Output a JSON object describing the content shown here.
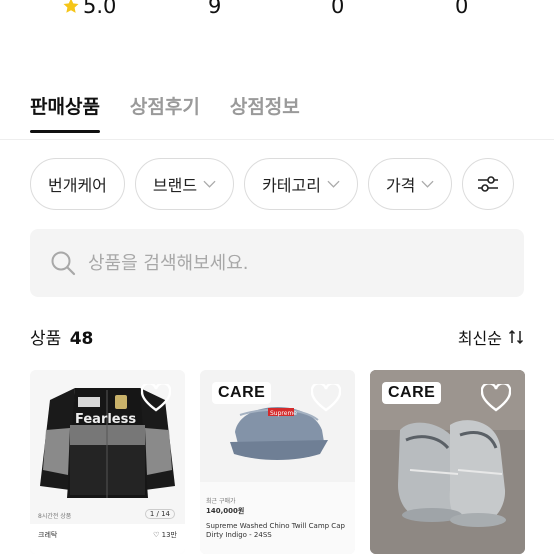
{
  "stats": {
    "rating": "5.0",
    "value_2": "9",
    "value_3": "0",
    "value_4": "0"
  },
  "tabs": [
    {
      "label": "판매상품",
      "active": true
    },
    {
      "label": "상점후기",
      "active": false
    },
    {
      "label": "상점정보",
      "active": false
    }
  ],
  "filters": [
    "번개케어",
    "브랜드",
    "카테고리",
    "가격"
  ],
  "search": {
    "placeholder": "상품을 검색해보세요."
  },
  "products_header": {
    "label": "상품",
    "count": "48",
    "sort": "최신순"
  },
  "cards": [
    {
      "badge": "",
      "mini_left": "8시간전 상품",
      "mini_page": "1 / 14",
      "mini_seller": "크레탁",
      "mini_like": "♡ 13만"
    },
    {
      "badge": "CARE",
      "mini_tag": "최근 구매가",
      "mini_price": "140,000원",
      "mini_title": "Supreme Washed Chino Twill Camp Cap Dirty Indigo - 24SS"
    },
    {
      "badge": "CARE"
    }
  ],
  "colors": {
    "accent": "#111111",
    "star": "#f5c518",
    "muted": "#9a9a9a"
  }
}
